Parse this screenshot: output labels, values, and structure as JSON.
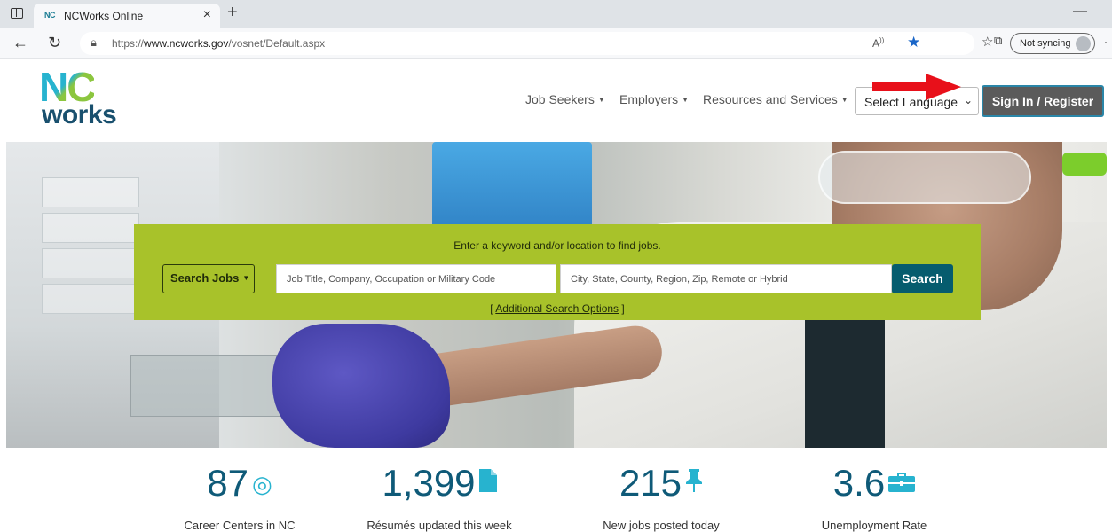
{
  "browser": {
    "tab_title": "NCWorks Online",
    "tab_favicon": "NC",
    "url_prefix": "https://",
    "url_host": "www.ncworks.gov",
    "url_path": "/vosnet/Default.aspx",
    "sync_label": "Not syncing",
    "icons": [
      "window-icon",
      "close-icon",
      "plus-icon",
      "back-icon",
      "refresh-icon",
      "lock-icon",
      "read-aloud-icon",
      "star-icon",
      "favorites-icon",
      "collections-icon",
      "avatar-icon",
      "more-icon"
    ]
  },
  "header": {
    "logo_top": "NC",
    "logo_bottom": "works",
    "nav": [
      {
        "label": "Job Seekers"
      },
      {
        "label": "Employers"
      },
      {
        "label": "Resources and Services"
      }
    ],
    "language_select": "Select Language",
    "signin_label": "Sign In / Register",
    "accent_color": "#27b3cf",
    "arrow_color": "#e8101a"
  },
  "search": {
    "prompt": "Enter a keyword and/or location to find jobs.",
    "type_label": "Search Jobs",
    "keyword_placeholder": "Job Title, Company, Occupation or Military Code",
    "location_placeholder": "City, State, County, Region, Zip, Remote or Hybrid",
    "button_label": "Search",
    "advanced_link": "Additional Search Options",
    "panel_color": "#a8c22a"
  },
  "stats": [
    {
      "value": "87",
      "label": "Career Centers in NC",
      "icon": "target-icon"
    },
    {
      "value": "1,399",
      "label": "Résumés updated this week",
      "icon": "document-icon"
    },
    {
      "value": "215",
      "label": "New jobs posted today",
      "icon": "pin-icon"
    },
    {
      "value": "3.6",
      "label": "Unemployment Rate",
      "icon": "briefcase-icon"
    }
  ]
}
